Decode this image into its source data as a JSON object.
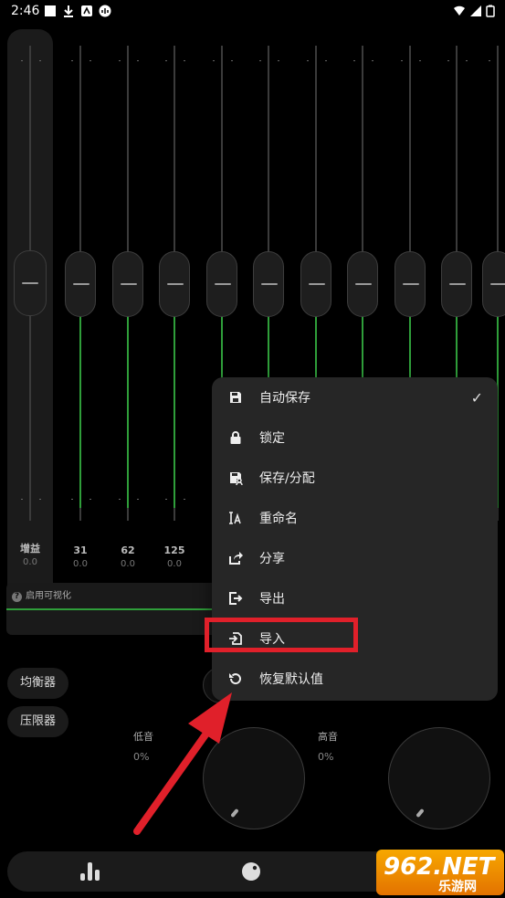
{
  "status": {
    "time": "2:46"
  },
  "gain": {
    "label": "增益",
    "value": "0.0"
  },
  "bands": [
    {
      "freq": "31",
      "value": "0.0"
    },
    {
      "freq": "62",
      "value": "0.0"
    },
    {
      "freq": "125",
      "value": "0.0"
    }
  ],
  "visualizer": {
    "help_symbol": "?",
    "label": "启用可视化"
  },
  "tabs": {
    "equalizer": "均衡器",
    "limiter": "压限器"
  },
  "bass": {
    "label": "低音",
    "value": "0%"
  },
  "treble": {
    "label": "高音",
    "value": "0%"
  },
  "menu": {
    "items": [
      {
        "label": "自动保存",
        "icon": "save-icon",
        "checked": true
      },
      {
        "label": "锁定",
        "icon": "lock-icon"
      },
      {
        "label": "保存/分配",
        "icon": "save-assign-icon"
      },
      {
        "label": "重命名",
        "icon": "rename-icon"
      },
      {
        "label": "分享",
        "icon": "share-icon"
      },
      {
        "label": "导出",
        "icon": "export-icon"
      },
      {
        "label": "导入",
        "icon": "import-icon"
      },
      {
        "label": "恢复默认值",
        "icon": "restore-icon"
      }
    ],
    "check_symbol": "✓"
  },
  "watermark": {
    "text": "962.NET",
    "sub": "乐游网"
  },
  "colors": {
    "accent_green": "#2f9e3a",
    "highlight_red": "#e0202a",
    "menu_bg": "#262626"
  }
}
